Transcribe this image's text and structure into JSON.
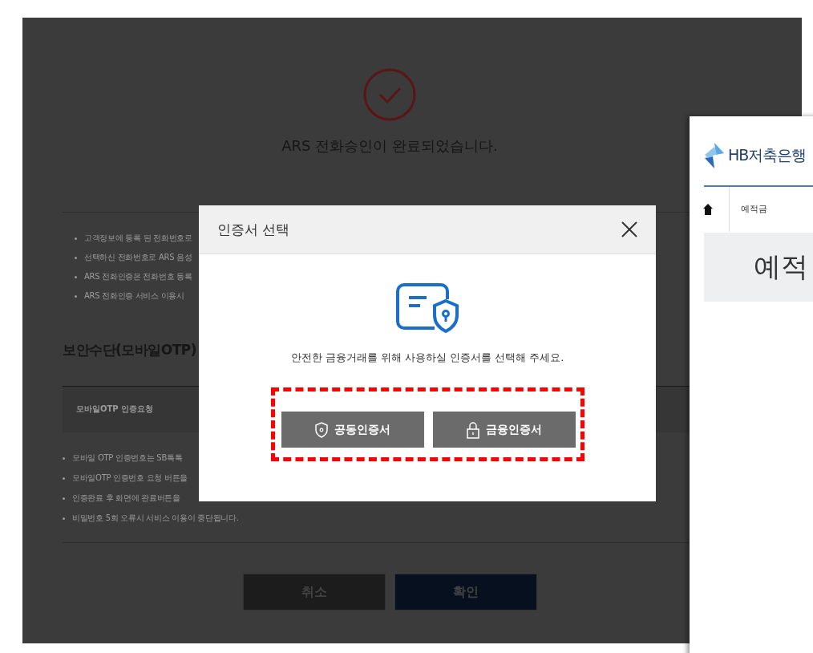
{
  "background_page": {
    "title": "ARS 전화승인이 완료되었습니다.",
    "notices": [
      "고객정보에 등록 된 전화번호로",
      "선택하신 전화번호로 ARS 음성",
      "ARS 전화인증은 전화번호 등록",
      "ARS 전화인증 서비스 이용시"
    ],
    "section_title": "보안수단(모바일OTP)",
    "table_label": "모바일OTP 인증요청",
    "otp_notices": [
      "모바일 OTP 인증번호는 SB톡톡",
      "모바일OTP 인증번호 요청 버튼을",
      "인증완료 후 화면에 완료버튼을",
      "비밀번호 5회 오류시 서비스 이용이 중단됩니다."
    ],
    "buttons": [
      {
        "label": "취소",
        "kind": "cancel"
      },
      {
        "label": "확인",
        "kind": "confirm"
      }
    ]
  },
  "side_page": {
    "logo_text": "HB저축은행",
    "breadcrumb": "예적금",
    "page_heading": "예적"
  },
  "dialog": {
    "title": "인증서 선택",
    "message": "안전한 금융거래를 위해 사용하실 인증서를 선택해 주세요.",
    "options": [
      {
        "label": "공동인증서",
        "kind": "shield"
      },
      {
        "label": "금융인증서",
        "kind": "lock"
      }
    ],
    "highlighted": true
  }
}
